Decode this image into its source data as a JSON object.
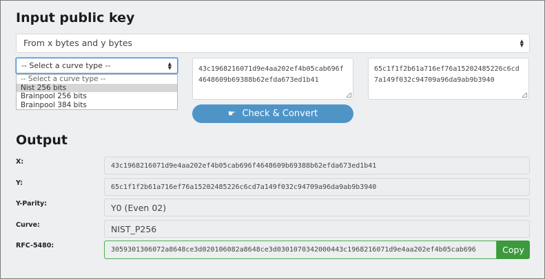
{
  "input_section": {
    "title": "Input public key",
    "source_select": {
      "selected": "From x bytes and y bytes"
    },
    "curve_select": {
      "selected": "-- Select a curve type --",
      "options": [
        "-- Select a curve type --",
        "Nist 256 bits",
        "Brainpool 256 bits",
        "Brainpool 384 bits"
      ],
      "highlighted_option": "Nist 256 bits"
    },
    "x_bytes": "43c1968216071d9e4aa202ef4b05cab696f4648609b69388b62efda673ed1b41",
    "y_bytes": "65c1f1f2b61a716ef76a15202485226c6cd7a149f032c94709a96da9ab9b3940",
    "check_button_label": "Check & Convert"
  },
  "output_section": {
    "title": "Output",
    "rows": [
      {
        "label": "X:",
        "value": "43c1968216071d9e4aa202ef4b05cab696f4648609b69388b62efda673ed1b41"
      },
      {
        "label": "Y:",
        "value": "65c1f1f2b61a716ef76a15202485226c6cd7a149f032c94709a96da9ab9b3940"
      },
      {
        "label": "Y-Parity:",
        "value": "Y0 (Even 02)"
      },
      {
        "label": "Curve:",
        "value": "NIST_P256"
      }
    ],
    "rfc": {
      "label": "RFC-5480:",
      "value": "3059301306072a8648ce3d020106082a8648ce3d0301070342000443c1968216071d9e4aa202ef4b05cab696",
      "copy_label": "Copy"
    }
  },
  "colors": {
    "background": "#edeff1",
    "check_button": "#4f94c7",
    "copy_button": "#3c9a3c",
    "focus_border": "#4a90d9"
  },
  "icons": {
    "check_button_icon": "pointing-hand-icon",
    "select_arrows": "updown-arrows-icon"
  }
}
